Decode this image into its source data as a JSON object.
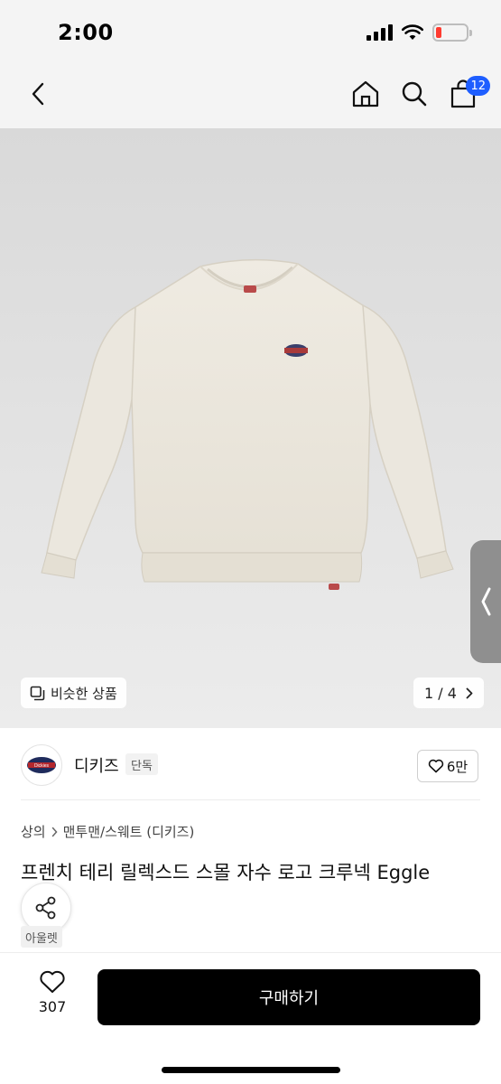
{
  "status_bar": {
    "time": "2:00"
  },
  "nav": {
    "cart_count": "12"
  },
  "gallery": {
    "similar_label": "비슷한 상품",
    "page_indicator": "1 / 4"
  },
  "brand": {
    "logo_text": "Dickies",
    "name": "디키즈",
    "tag": "단독",
    "likes": "6만"
  },
  "product": {
    "breadcrumb": [
      "상의",
      "맨투맨/스웨트 (디키즈)"
    ],
    "title": "프렌치 테리 릴렉스드 스몰 자수 로고 크루넥 Eggle",
    "tag": "아울렛"
  },
  "bottom": {
    "wish_count": "307",
    "buy_label": "구매하기"
  },
  "colors": {
    "badge": "#1e5eff",
    "buy_button": "#000000",
    "battery_low": "#ff3b30"
  }
}
